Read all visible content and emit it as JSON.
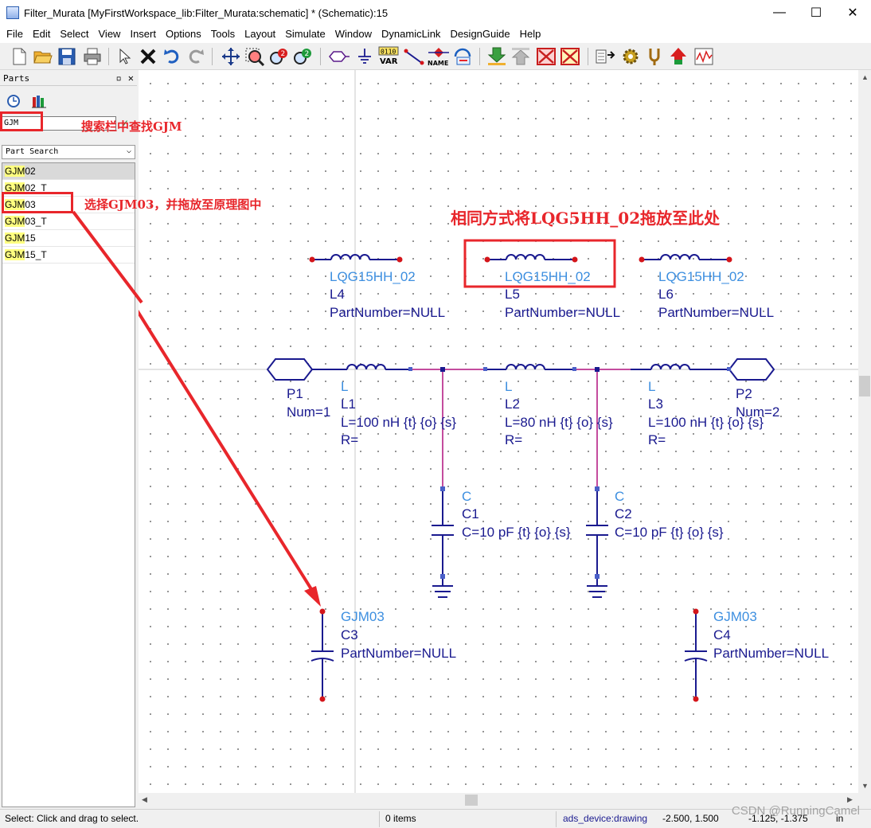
{
  "window": {
    "title": "Filter_Murata [MyFirstWorkspace_lib:Filter_Murata:schematic] * (Schematic):15",
    "minimize": "—",
    "maximize": "☐",
    "close": "✕"
  },
  "menu": [
    "File",
    "Edit",
    "Select",
    "View",
    "Insert",
    "Options",
    "Tools",
    "Layout",
    "Simulate",
    "Window",
    "DynamicLink",
    "DesignGuide",
    "Help"
  ],
  "toolbar": {
    "var_label": "VAR",
    "var_bits": "0110",
    "name_label": "NAME"
  },
  "parts_panel": {
    "header": "Parts",
    "search_value": "GJM",
    "search_mode": "Part Search",
    "results": [
      {
        "prefix": "GJM",
        "suffix": "02"
      },
      {
        "prefix": "GJM",
        "suffix": "02_T"
      },
      {
        "prefix": "GJM",
        "suffix": "03"
      },
      {
        "prefix": "GJM",
        "suffix": "03_T"
      },
      {
        "prefix": "GJM",
        "suffix": "15"
      },
      {
        "prefix": "GJM",
        "suffix": "15_T"
      }
    ]
  },
  "annotations": {
    "search_hint": "搜索栏中查找GJM",
    "select_hint": "选择GJM03，并拖放至原理图中",
    "drag_hint": "相同方式将LQG5HH_02拖放至此处"
  },
  "schematic": {
    "L4": {
      "model": "LQG15HH_02",
      "name": "L4",
      "param": "PartNumber=NULL"
    },
    "L5": {
      "model": "LQG15HH_02",
      "name": "L5",
      "param": "PartNumber=NULL"
    },
    "L6": {
      "model": "LQG15HH_02",
      "name": "L6",
      "param": "PartNumber=NULL"
    },
    "P1": {
      "name": "P1",
      "num": "Num=1"
    },
    "P2": {
      "name": "P2",
      "num": "Num=2"
    },
    "L1": {
      "type": "L",
      "name": "L1",
      "value": "L=100 nH {t} {o} {s}",
      "r": "R="
    },
    "L2": {
      "type": "L",
      "name": "L2",
      "value": "L=80 nH {t} {o} {s}",
      "r": "R="
    },
    "L3": {
      "type": "L",
      "name": "L3",
      "value": "L=100 nH {t} {o} {s}",
      "r": "R="
    },
    "C1": {
      "type": "C",
      "name": "C1",
      "value": "C=10 pF {t} {o} {s}"
    },
    "C2": {
      "type": "C",
      "name": "C2",
      "value": "C=10 pF {t} {o} {s}"
    },
    "C3": {
      "model": "GJM03",
      "name": "C3",
      "param": "PartNumber=NULL"
    },
    "C4": {
      "model": "GJM03",
      "name": "C4",
      "param": "PartNumber=NULL"
    }
  },
  "status": {
    "hint": "Select: Click and drag to select.",
    "items": "0 items",
    "layer": "ads_device:drawing",
    "coord1": "-2.500, 1.500",
    "coord2": "-1.125, -1.375",
    "unit": "in"
  },
  "watermark": "CSDN @RunningCamel",
  "colors": {
    "annotation_red": "#e8262b",
    "wire_magenta": "#b0107f",
    "component_blue": "#1a1a8f",
    "label_light_blue": "#3d8fe0",
    "pin_red": "#d4151a"
  }
}
